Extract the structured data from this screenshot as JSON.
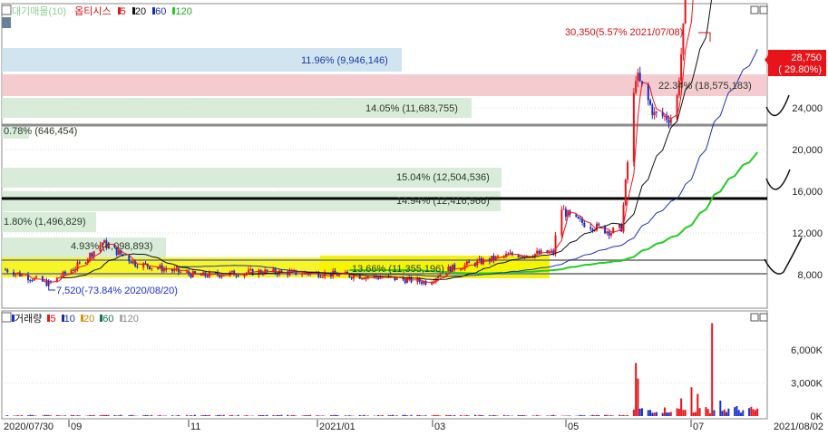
{
  "price_panel": {
    "legend": {
      "vol_toggle": "대기매물(10)",
      "stock": "옵티시스",
      "ma_labels": [
        "5",
        "20",
        "60",
        "120"
      ]
    },
    "max_callout": "30,350(5.57% 2021/07/08)",
    "min_callout": "7,520(-73.84% 2020/08/20)",
    "current_price": "28,750",
    "current_change": "( 29.80%)",
    "y_ticks": [
      "24,000",
      "20,000",
      "16,000",
      "12,000",
      "8,000"
    ],
    "volume_profile": [
      {
        "label": "11.96% (9,946,146)",
        "kind": "blue"
      },
      {
        "label": "22.34% (18,575,183)",
        "kind": "red"
      },
      {
        "label": "14.05% (11,683,755)",
        "kind": "green"
      },
      {
        "label": "0.78% (646,454)",
        "kind": "green"
      },
      {
        "label": "15.04% (12,504,536)",
        "kind": "green"
      },
      {
        "label": "14.94% (12,416,966)",
        "kind": "green"
      },
      {
        "label": "1.80% (1,496,829)",
        "kind": "green"
      },
      {
        "label": "4.93% (4,098,893)",
        "kind": "green"
      },
      {
        "label": "13.66% (11,355,196)",
        "kind": "yellow"
      }
    ]
  },
  "volume_panel": {
    "legend": {
      "title": "거래량",
      "ma_labels": [
        "5",
        "10",
        "20",
        "60",
        "120"
      ]
    },
    "y_ticks": [
      "6,000K",
      "3,000K",
      "0K"
    ]
  },
  "x_axis": {
    "labels": [
      "2020/07/30",
      "09",
      "11",
      "2021/01",
      "03",
      "05",
      "07",
      "2021/08/02"
    ]
  },
  "colors": {
    "up": "#e8141a",
    "down": "#1a2fd0",
    "ma5": "#e8141a",
    "ma20": "#111111",
    "ma60": "#1a2fb0",
    "ma120": "#22cc22",
    "profile_blue": "#c9e0ef",
    "profile_red": "#f2c3c8",
    "profile_green": "#d2e9d2",
    "profile_yellow": "#f5f500"
  },
  "chart_data": {
    "type": "candlestick",
    "x_start": "2020/07/30",
    "x_end": "2021/08/02",
    "y_range": [
      6500,
      31000
    ],
    "price_path": [
      [
        "2020/07/30",
        8200
      ],
      [
        "2020/08/20",
        7520
      ],
      [
        "2020/09/05",
        8500
      ],
      [
        "2020/09/15",
        9500
      ],
      [
        "2020/10/01",
        8500
      ],
      [
        "2020/11/01",
        7900
      ],
      [
        "2020/12/01",
        8100
      ],
      [
        "2021/01/01",
        8000
      ],
      [
        "2021/02/01",
        7800
      ],
      [
        "2021/02/20",
        7600
      ],
      [
        "2021/03/01",
        8200
      ],
      [
        "2021/04/01",
        8900
      ],
      [
        "2021/04/22",
        9000
      ],
      [
        "2021/04/25",
        11200
      ],
      [
        "2021/05/01",
        10600
      ],
      [
        "2021/05/20",
        10000
      ],
      [
        "2021/05/25",
        10200
      ],
      [
        "2021/06/01",
        17500
      ],
      [
        "2021/06/10",
        15600
      ],
      [
        "2021/06/20",
        15400
      ],
      [
        "2021/06/23",
        18500
      ],
      [
        "2021/06/28",
        24000
      ],
      [
        "2021/07/05",
        27500
      ],
      [
        "2021/07/08",
        30350
      ],
      [
        "2021/07/12",
        26000
      ],
      [
        "2021/07/20",
        24500
      ],
      [
        "2021/07/26",
        22000
      ],
      [
        "2021/07/29",
        22150
      ],
      [
        "2021/08/02",
        28750
      ]
    ],
    "last_candle": {
      "date": "2021/08/02",
      "open": 22150,
      "high": 28750,
      "low": 22150,
      "close": 28750
    },
    "volume_spikes": [
      [
        "2021/06/01",
        4800
      ],
      [
        "2021/06/02",
        3400
      ],
      [
        "2021/06/23",
        1600
      ],
      [
        "2021/06/28",
        2600
      ],
      [
        "2021/07/01",
        2000
      ],
      [
        "2021/07/08",
        8400
      ],
      [
        "2021/07/12",
        1400
      ],
      [
        "2021/07/20",
        900
      ],
      [
        "2021/08/02",
        5400
      ]
    ]
  }
}
